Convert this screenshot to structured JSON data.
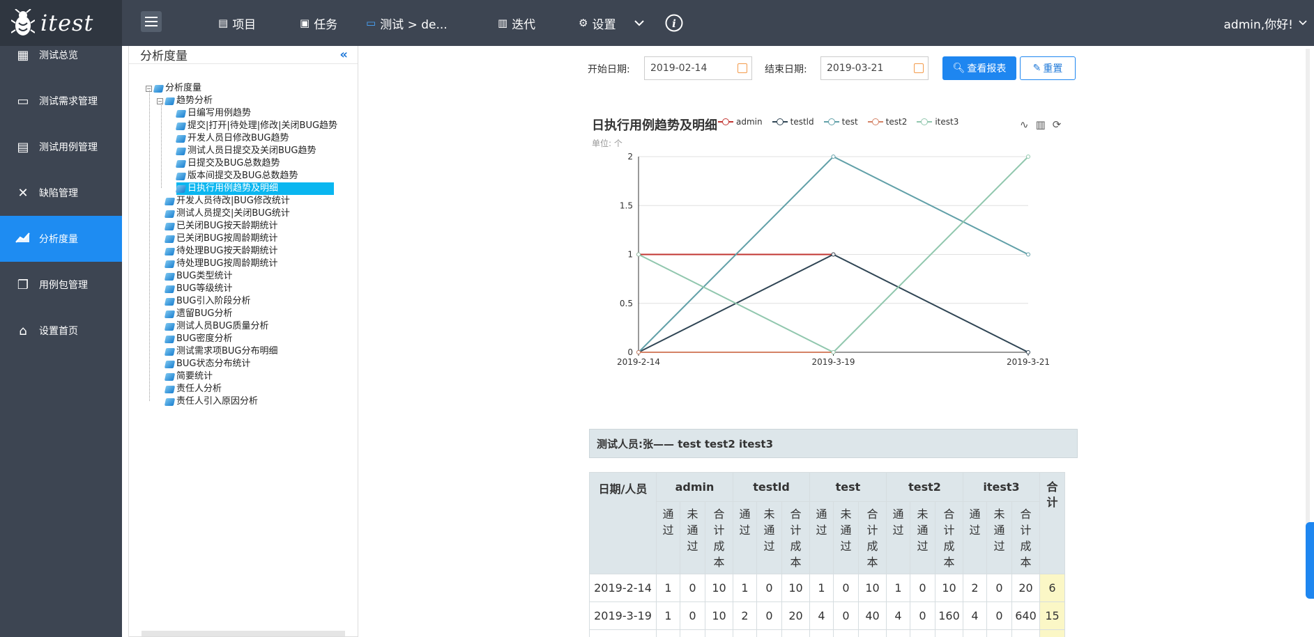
{
  "brand": {
    "name": "itest"
  },
  "topnav": {
    "items": [
      {
        "label": "项目",
        "icon": "folder-icon"
      },
      {
        "label": "任务",
        "icon": "clipboard-icon"
      },
      {
        "label": "测试 > de...",
        "icon": "monitor-icon"
      },
      {
        "label": "迭代",
        "icon": "book-icon"
      },
      {
        "label": "设置",
        "icon": "gear-icon"
      }
    ],
    "user": "admin,你好!"
  },
  "sidebar": {
    "items": [
      {
        "label": "测试总览",
        "icon": "dashboard-icon"
      },
      {
        "label": "测试需求管理",
        "icon": "inbox-icon"
      },
      {
        "label": "测试用例管理",
        "icon": "document-icon"
      },
      {
        "label": "缺陷管理",
        "icon": "tools-icon"
      },
      {
        "label": "分析度量",
        "icon": "chart-icon",
        "active": true
      },
      {
        "label": "用例包管理",
        "icon": "files-icon"
      },
      {
        "label": "设置首页",
        "icon": "home-icon"
      }
    ]
  },
  "tree": {
    "title": "分析度量",
    "root": "分析度量",
    "group": "趋势分析",
    "group_items": [
      "日编写用例趋势",
      "提交|打开|待处理|修改|关闭BUG趋势",
      "开发人员日修改BUG趋势",
      "测试人员日提交及关闭BUG趋势",
      "日提交及BUG总数趋势",
      "版本间提交及BUG总数趋势",
      "日执行用例趋势及明细"
    ],
    "items": [
      "开发人员待改|BUG修改统计",
      "测试人员提交|关闭BUG统计",
      "已关闭BUG按天龄期统计",
      "已关闭BUG按周龄期统计",
      "待处理BUG按天龄期统计",
      "待处理BUG按周龄期统计",
      "BUG类型统计",
      "BUG等级统计",
      "BUG引入阶段分析",
      "遗留BUG分析",
      "测试人员BUG质量分析",
      "BUG密度分析",
      "测试需求项BUG分布明细",
      "BUG状态分布统计",
      "简要统计",
      "责任人分析",
      "责任人引入原因分析"
    ]
  },
  "filter": {
    "start_label": "开始日期:",
    "start_value": "2019-02-14",
    "end_label": "结束日期:",
    "end_value": "2019-03-21",
    "query_button": "查看报表",
    "reset_button": "重置"
  },
  "chart_data": {
    "type": "line",
    "title": "日执行用例趋势及明细",
    "unit": "单位: 个",
    "x": [
      "2019-2-14",
      "2019-3-19",
      "2019-3-21"
    ],
    "ylim": [
      0,
      2
    ],
    "yticks": [
      "0",
      "0.5",
      "1",
      "1.5",
      "2"
    ],
    "grid": true,
    "legend": "top",
    "series": [
      {
        "name": "admin",
        "color": "#c23531",
        "values": [
          1,
          1,
          null
        ]
      },
      {
        "name": "testld",
        "color": "#2f4554",
        "values": [
          0,
          1,
          0
        ]
      },
      {
        "name": "test",
        "color": "#61a0a8",
        "values": [
          0,
          2,
          1
        ]
      },
      {
        "name": "test2",
        "color": "#d48265",
        "values": [
          0,
          0,
          null
        ]
      },
      {
        "name": "itest3",
        "color": "#91c7ae",
        "values": [
          1,
          0,
          2
        ]
      }
    ]
  },
  "people": {
    "text": "测试人员:张—— test test2 itest3"
  },
  "table": {
    "corner": "日期/人员",
    "total_header": "合计",
    "people": [
      "admin",
      "testld",
      "test",
      "test2",
      "itest3"
    ],
    "sub_headers": [
      "通过",
      "未通过",
      "合计成本"
    ],
    "rows": [
      {
        "date": "2019-2-14",
        "cells": [
          "1",
          "0",
          "10",
          "1",
          "0",
          "10",
          "1",
          "0",
          "10",
          "1",
          "0",
          "10",
          "2",
          "0",
          "20"
        ],
        "total": "6"
      },
      {
        "date": "2019-3-19",
        "cells": [
          "1",
          "0",
          "10",
          "2",
          "0",
          "20",
          "4",
          "0",
          "40",
          "4",
          "0",
          "160",
          "4",
          "0",
          "640"
        ],
        "total": "15"
      }
    ]
  }
}
